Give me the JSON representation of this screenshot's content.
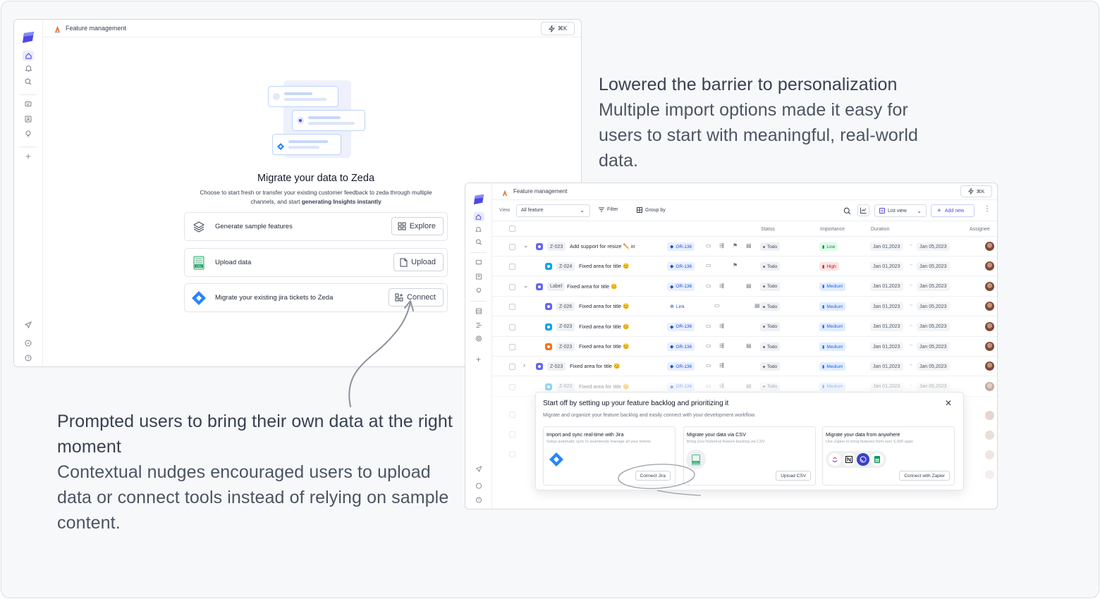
{
  "win1": {
    "title": "Feature management",
    "shortcut": "⌘K",
    "heading": "Migrate your data to Zeda",
    "subtext_line1": "Choose to start fresh or transfer your existing customer feedback to zeda through multiple",
    "subtext_line2_prefix": "channels, and start ",
    "subtext_line2_bold": "generating Insights instantly",
    "options": [
      {
        "label": "Generate sample features",
        "icon": "layers-icon",
        "button": "Explore",
        "button_icon": "grid-icon"
      },
      {
        "label": "Upload data",
        "icon": "csv-sheet-icon",
        "button": "Upload",
        "button_icon": "file-icon"
      },
      {
        "label": "Migrate your existing jira tickets to Zeda",
        "icon": "jira-icon",
        "button": "Connect",
        "button_icon": "grid-plus-icon"
      }
    ]
  },
  "captions": {
    "right_heading": "Lowered the barrier to personalization",
    "right_body": "Multiple import options made it easy for users to start with meaningful, real-world data.",
    "left_heading": "Prompted users to bring their own data at the right moment",
    "left_body": "Contextual nudges encouraged users to upload data or connect tools instead of relying on sample content."
  },
  "win2": {
    "title": "Feature management",
    "shortcut": "⌘K",
    "toolbar": {
      "view_label": "View",
      "view_value": "All feature",
      "filter": "Filter",
      "group_by": "Group by",
      "list_view": "List view",
      "add_new": "Add new"
    },
    "columns": [
      "Status",
      "Importance",
      "Duration",
      "Assignee"
    ],
    "rows": [
      {
        "id": "Z-023",
        "title": "Add support for resize ✏️ in",
        "link": "OR-136",
        "status": "Todo",
        "importance": "Low",
        "start": "Jan 01,2023",
        "end": "Jan 05,2023",
        "color": "#6366f1"
      },
      {
        "id": "Z-024",
        "title": "Fixed area for title 😊",
        "link": "OR-136",
        "status": "Todo",
        "importance": "High",
        "start": "Jan 01,2023",
        "end": "Jan 05,2023",
        "color": "#0ea5e9"
      },
      {
        "id": "Label",
        "title": "Fixed area for title 😊",
        "link": "OR-136",
        "status": "Todo",
        "importance": "Medium",
        "start": "Jan 01,2023",
        "end": "Jan 05,2023",
        "color": "#6366f1"
      },
      {
        "id": "Z-026",
        "title": "Fixed area for title 😊",
        "link": "Link",
        "status": "Todo",
        "importance": "Medium",
        "start": "Jan 01,2023",
        "end": "Jan 05,2023",
        "color": "#6366f1"
      },
      {
        "id": "Z-023",
        "title": "Fixed area for title 😊",
        "link": "OR-136",
        "status": "Todo",
        "importance": "Medium",
        "start": "Jan 01,2023",
        "end": "Jan 05,2023",
        "color": "#0ea5e9"
      },
      {
        "id": "Z-023",
        "title": "Fixed area for title 😊",
        "link": "OR-136",
        "status": "Todo",
        "importance": "Medium",
        "start": "Jan 01,2023",
        "end": "Jan 05,2023",
        "color": "#f97316"
      },
      {
        "id": "Z-023",
        "title": "Fixed area for title 😊",
        "link": "OR-136",
        "status": "Todo",
        "importance": "Medium",
        "start": "Jan 01,2023",
        "end": "Jan 05,2023",
        "color": "#6366f1"
      },
      {
        "id": "Z-023",
        "title": "Fixed area for title 😊",
        "link": "OR-136",
        "status": "Todo",
        "importance": "Medium",
        "start": "Jan 01,2023",
        "end": "Jan 05,2023",
        "color": "#0ea5e9"
      }
    ],
    "modal": {
      "title": "Start off by setting up your feature backlog and prioritizing it",
      "subtitle": "Migrate and organize your feature backlog and easily connect with your development workflow.",
      "cards": [
        {
          "title": "Import and sync real-time with Jira",
          "desc": "Setup automatic sync to seamlessly manage all your tickets",
          "button": "Connect Jira"
        },
        {
          "title": "Migrate your data via CSV",
          "desc": "Bring your historical feature backlog via CSV",
          "button": "Upload CSV"
        },
        {
          "title": "Migrate your data from anywhere",
          "desc": "Use Zapier to bring features from over 5,000 apps",
          "button": "Connect with Zapier"
        }
      ]
    }
  },
  "colors": {
    "brand": "#4f46e5",
    "jira": "#2684ff",
    "csv_green": "#21a366",
    "low": "#16a34a",
    "high": "#dc2626",
    "medium": "#2563eb"
  }
}
